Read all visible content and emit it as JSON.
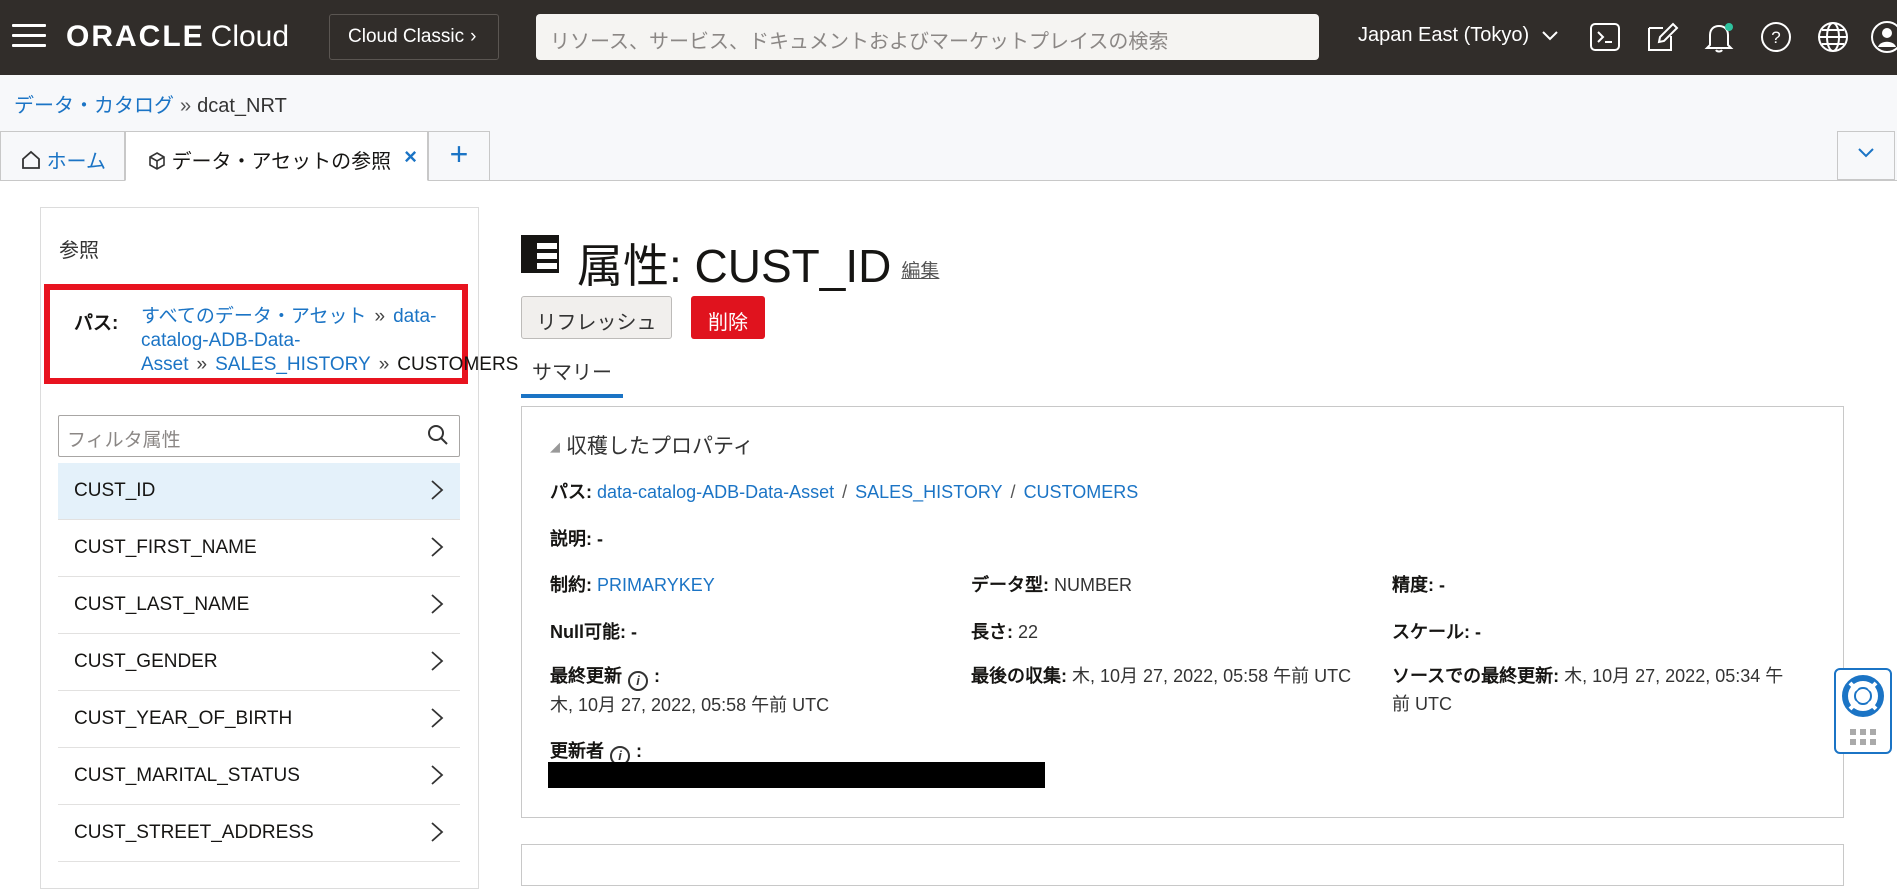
{
  "header": {
    "logo_brand": "ORACLE",
    "logo_product": "Cloud",
    "classic_label": "Cloud Classic",
    "search_placeholder": "リソース、サービス、ドキュメントおよびマーケットプレイスの検索",
    "region": "Japan East (Tokyo)"
  },
  "breadcrumb": {
    "parent": "データ・カタログ",
    "separator": "»",
    "current": "dcat_NRT"
  },
  "tabs": {
    "home": "ホーム",
    "active": "データ・アセットの参照",
    "close": "×",
    "add": "+"
  },
  "browse": {
    "title": "参照",
    "path_label": "パス:",
    "path": [
      "すべてのデータ・アセット",
      "data-catalog-ADB-Data-Asset",
      "SALES_HISTORY",
      "CUSTOMERS"
    ],
    "path_sep": "»",
    "filter_placeholder": "フィルタ属性",
    "attributes": [
      "CUST_ID",
      "CUST_FIRST_NAME",
      "CUST_LAST_NAME",
      "CUST_GENDER",
      "CUST_YEAR_OF_BIRTH",
      "CUST_MARITAL_STATUS",
      "CUST_STREET_ADDRESS"
    ]
  },
  "main": {
    "title": "属性: CUST_ID",
    "edit": "編集",
    "refresh": "リフレッシュ",
    "delete": "削除",
    "subtab": "サマリー",
    "section_title": "収穫したプロパティ",
    "path_key": "パス:",
    "path_parts": [
      "data-catalog-ADB-Data-Asset",
      "SALES_HISTORY",
      "CUSTOMERS"
    ],
    "path_slash": "/",
    "description_key": "説明:",
    "description_val": "-",
    "constraint_key": "制約:",
    "constraint_val": "PRIMARYKEY",
    "datatype_key": "データ型:",
    "datatype_val": "NUMBER",
    "precision_key": "精度:",
    "precision_val": "-",
    "nullable_key": "Null可能:",
    "nullable_val": "-",
    "length_key": "長さ:",
    "length_val": "22",
    "scale_key": "スケール:",
    "scale_val": "-",
    "last_updated_key": "最終更新",
    "last_updated_val": "木, 10月 27, 2022, 05:58 午前 UTC",
    "last_harvested_key": "最後の収集:",
    "last_harvested_val": "木, 10月 27, 2022, 05:58 午前 UTC",
    "source_updated_key": "ソースでの最終更新:",
    "source_updated_val_1": "木, 10月 27, 2022, 05:34 午",
    "source_updated_val_2": "前 UTC",
    "updated_by_key": "更新者",
    "colon": ":"
  },
  "colors": {
    "header_bg": "#312d2a",
    "link": "#1b74c5",
    "danger": "#e0131e",
    "highlight": "#e8131f"
  }
}
